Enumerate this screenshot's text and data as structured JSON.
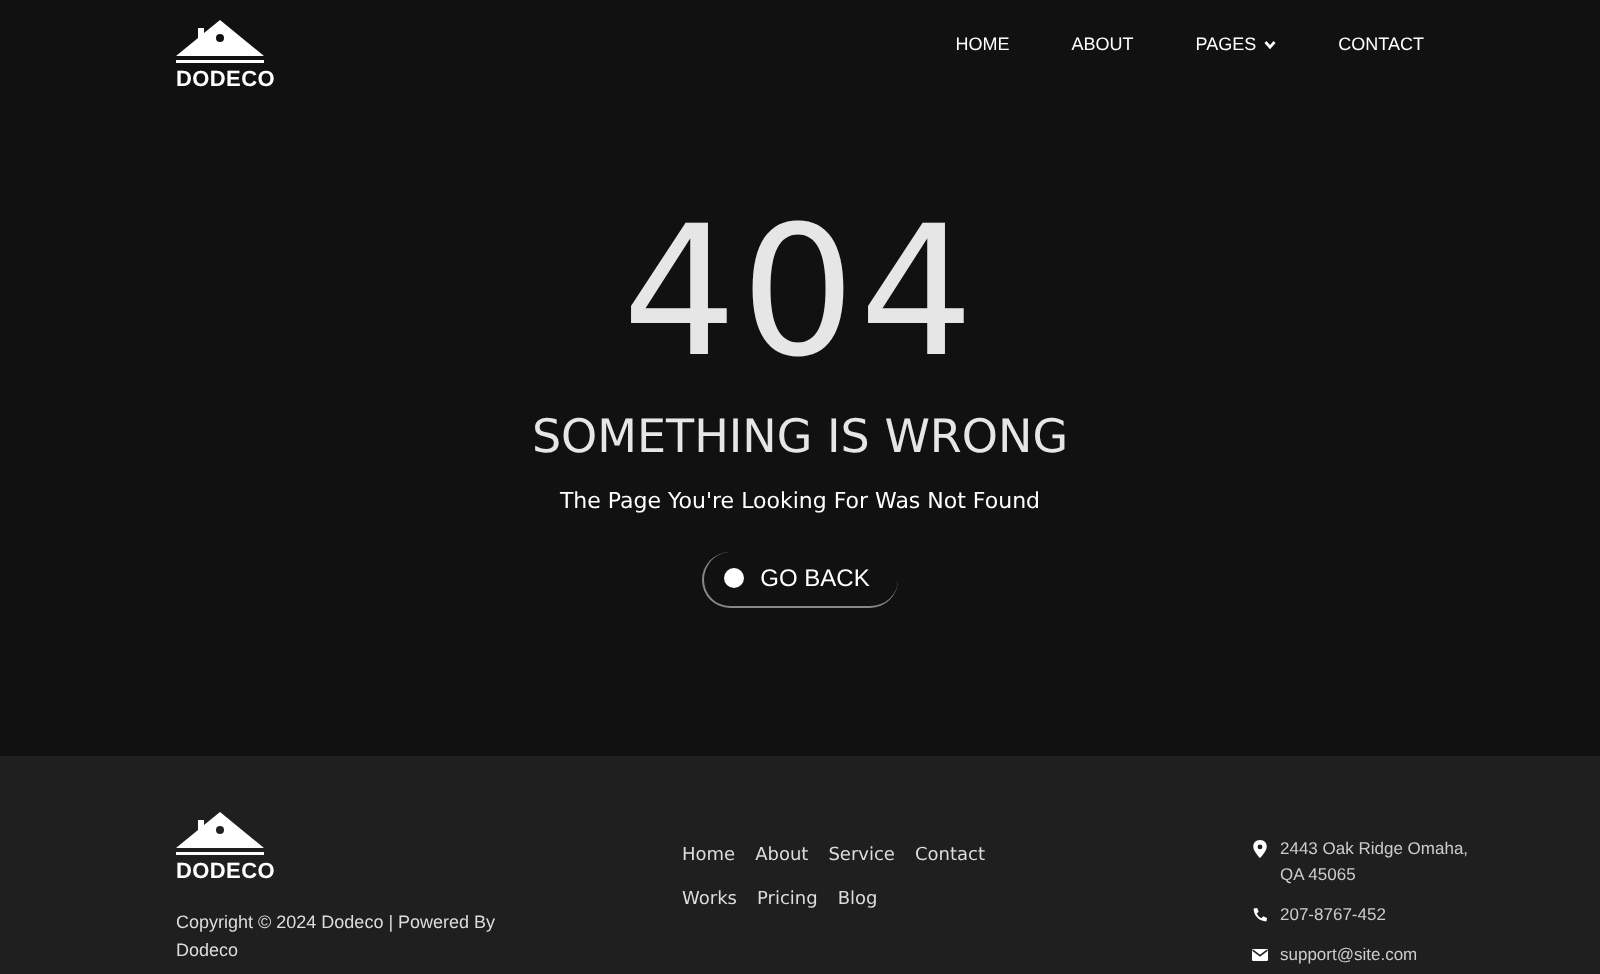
{
  "header": {
    "logo": "DODECO",
    "nav": [
      {
        "label": "HOME",
        "dropdown": false
      },
      {
        "label": "ABOUT",
        "dropdown": false
      },
      {
        "label": "PAGES",
        "dropdown": true
      },
      {
        "label": "CONTACT",
        "dropdown": false
      }
    ]
  },
  "error": {
    "code": "404",
    "title": "SOMETHING IS WRONG",
    "message": "The Page You're Looking For Was Not Found",
    "button": "GO BACK"
  },
  "footer": {
    "logo": "DODECO",
    "copyright": "Copyright © 2024 Dodeco | Powered By Dodeco",
    "links": [
      [
        "Home",
        "About",
        "Service",
        "Contact"
      ],
      [
        "Works",
        "Pricing",
        "Blog"
      ]
    ],
    "contacts": [
      {
        "kind": "address",
        "text": "2443 Oak Ridge Omaha, QA 45065"
      },
      {
        "kind": "phone",
        "text": "207-8767-452"
      },
      {
        "kind": "email",
        "text": "support@site.com"
      }
    ]
  }
}
